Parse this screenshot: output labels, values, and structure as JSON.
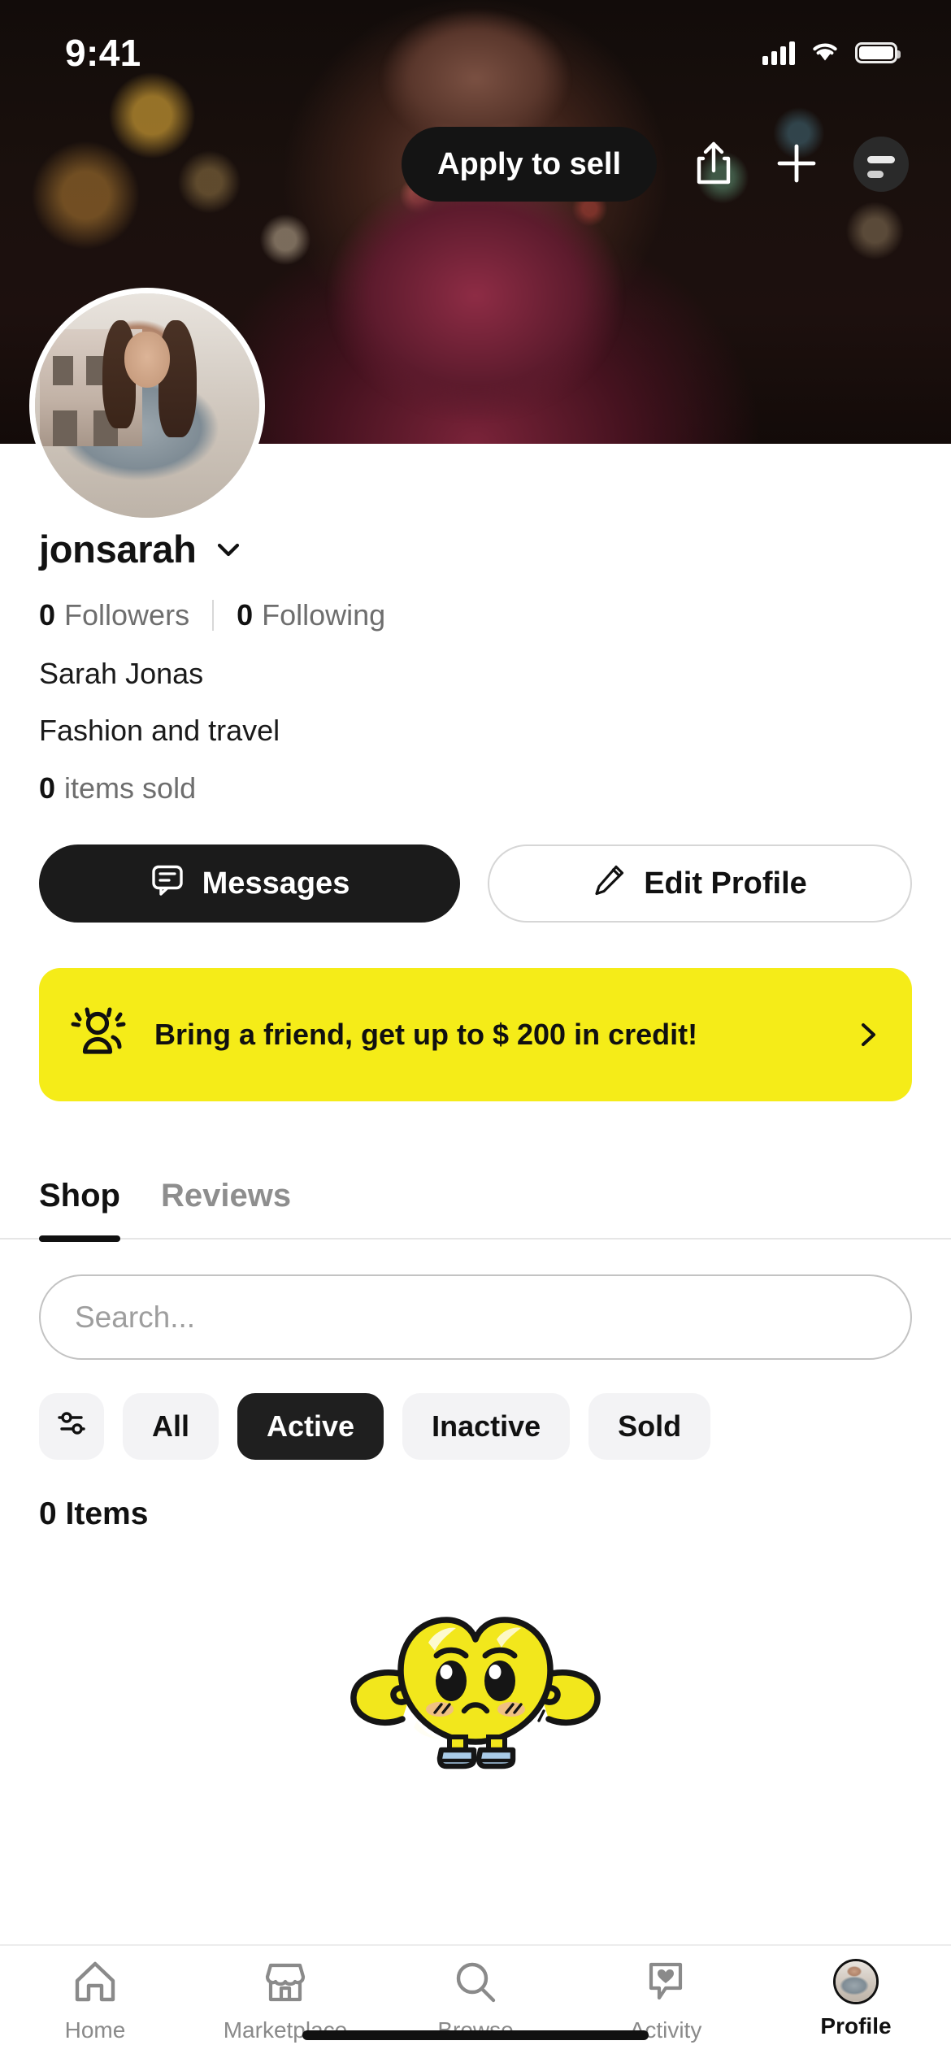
{
  "status_bar": {
    "time": "9:41",
    "cellular_icon": "cellular-signal-icon",
    "wifi_icon": "wifi-icon",
    "battery_icon": "battery-icon"
  },
  "header": {
    "apply_label": "Apply to sell",
    "share_icon": "share-icon",
    "add_icon": "plus-icon",
    "menu_icon": "account-menu-icon"
  },
  "profile": {
    "username": "jonsarah",
    "chevron_icon": "chevron-down-icon",
    "followers_count": "0",
    "followers_label": "Followers",
    "following_count": "0",
    "following_label": "Following",
    "full_name": "Sarah Jonas",
    "bio": "Fashion and travel",
    "items_sold_count": "0",
    "items_sold_label": "items sold",
    "messages_label": "Messages",
    "messages_icon": "message-bubble-icon",
    "edit_profile_label": "Edit Profile",
    "edit_profile_icon": "pencil-icon",
    "avatar_icon": "profile-avatar"
  },
  "referral": {
    "text": "Bring a friend, get up to $ 200 in credit!",
    "icon": "people-sparkle-icon",
    "chevron_icon": "chevron-right-icon",
    "background_color": "#f5ec18"
  },
  "tabs": [
    {
      "label": "Shop",
      "active": true
    },
    {
      "label": "Reviews",
      "active": false
    }
  ],
  "search": {
    "placeholder": "Search...",
    "value": ""
  },
  "filters": {
    "filter_icon": "sliders-filter-icon",
    "chips": [
      {
        "label": "All",
        "active": false
      },
      {
        "label": "Active",
        "active": true
      },
      {
        "label": "Inactive",
        "active": false
      },
      {
        "label": "Sold",
        "active": false
      }
    ]
  },
  "items": {
    "count_label": "0 Items",
    "empty_mascot_icon": "yellow-heart-mascot-icon"
  },
  "bottom_nav": [
    {
      "label": "Home",
      "icon": "home-icon",
      "active": false
    },
    {
      "label": "Marketplace",
      "icon": "storefront-icon",
      "active": false
    },
    {
      "label": "Browse",
      "icon": "search-magnifier-icon",
      "active": false
    },
    {
      "label": "Activity",
      "icon": "heart-bubble-icon",
      "active": false
    },
    {
      "label": "Profile",
      "icon": "profile-avatar-icon",
      "active": true
    }
  ],
  "colors": {
    "accent_yellow": "#f5ec18",
    "dark": "#1b1b1b",
    "muted_text": "#8a8a8a",
    "chip_bg": "#f3f3f5"
  }
}
